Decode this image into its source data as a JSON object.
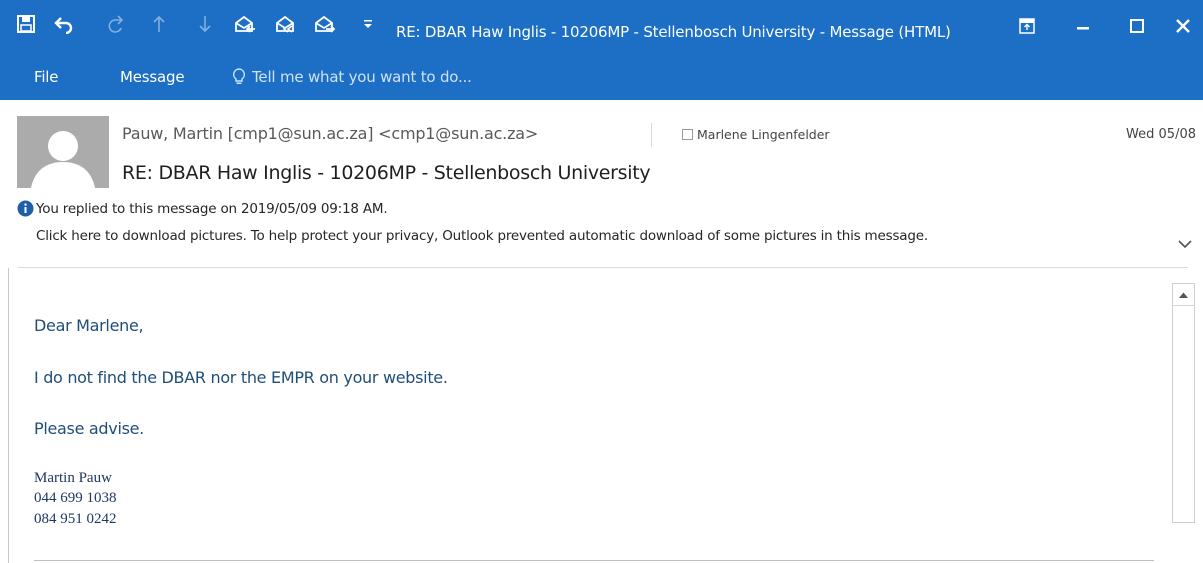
{
  "window": {
    "title": "RE: DBAR Haw Inglis - 10206MP - Stellenbosch University - Message (HTML)",
    "accent_color": "#1c6fc4"
  },
  "quick_access": [
    {
      "name": "save-icon"
    },
    {
      "name": "undo-icon"
    },
    {
      "name": "redo-icon"
    },
    {
      "name": "previous-item-icon"
    },
    {
      "name": "next-item-icon"
    },
    {
      "name": "reply-icon"
    },
    {
      "name": "reply-all-icon"
    },
    {
      "name": "forward-icon"
    },
    {
      "name": "customize-quick-access-icon"
    }
  ],
  "window_controls": [
    "ribbon-display-options-icon",
    "minimize-icon",
    "maximize-icon",
    "close-icon"
  ],
  "ribbon": {
    "tabs": [
      "File",
      "Message"
    ],
    "tell_me": "Tell me what you want to do..."
  },
  "message": {
    "sender": "Pauw, Martin [cmp1@sun.ac.za] <cmp1@sun.ac.za>",
    "recipient": "Marlene Lingenfelder",
    "date": "Wed 05/08",
    "subject": "RE: DBAR Haw Inglis - 10206MP - Stellenbosch University",
    "info_line1": "You replied to this message on 2019/05/09 09:18 AM.",
    "info_line2": "Click here to download pictures. To help protect your privacy, Outlook prevented automatic download of some pictures in this message.",
    "body": {
      "greeting": "Dear Marlene,",
      "line1": "I do not find the DBAR nor the EMPR  on your website.",
      "line2": "Please advise.",
      "signature_name": "Martin Pauw",
      "signature_phone1": "044 699 1038",
      "signature_phone2": "084 951 0242"
    },
    "text_color": "#1f4e79"
  }
}
